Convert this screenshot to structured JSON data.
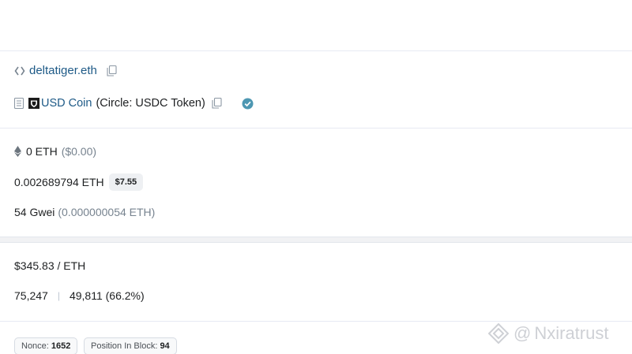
{
  "to": {
    "address_label": "deltatiger.eth",
    "icons": {
      "contract": "code-brackets-icon",
      "copy": "copy-icon"
    }
  },
  "token": {
    "name": "USD Coin",
    "detail": "(Circle: USDC Token)",
    "icons": {
      "document": "document-icon",
      "token_logo": "usdc-shield-logo",
      "copy": "copy-icon",
      "verified": "verified-check-icon"
    },
    "verified_color": "#4d97b2"
  },
  "value": {
    "amount": "0 ETH",
    "usd": "($0.00)",
    "icon": "ethereum-icon"
  },
  "fee": {
    "amount": "0.002689794 ETH",
    "usd_badge": "$7.55"
  },
  "gas_price": {
    "gwei": "54 Gwei",
    "eth": "(0.000000054 ETH)"
  },
  "ether_price": "$345.83 / ETH",
  "gas": {
    "limit": "75,247",
    "separator": "|",
    "used": "49,811 (66.2%)"
  },
  "badges": {
    "nonce_label": "Nonce:",
    "nonce_value": "1652",
    "position_label": "Position In Block:",
    "position_value": "94"
  },
  "watermark": {
    "at": "@",
    "text": "Nxiratrust"
  }
}
